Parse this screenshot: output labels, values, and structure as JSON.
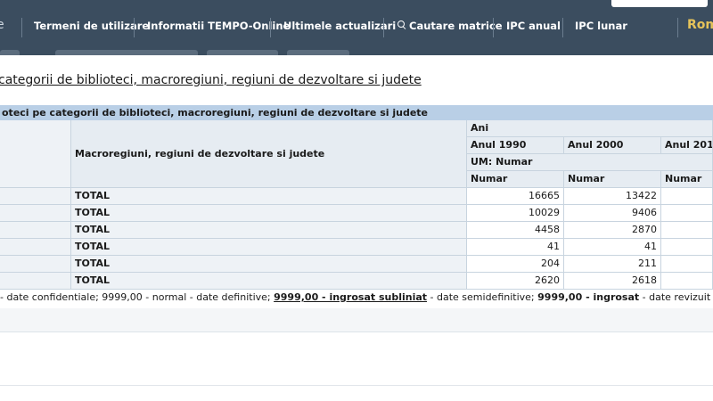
{
  "nav": {
    "left_fragment": "e",
    "items": [
      "Termeni de utilizare",
      "Informatii TEMPO-Online",
      "Ultimele actualizari",
      "Cautare matrice",
      "IPC anual",
      "IPC lunar"
    ],
    "brand_fragment": "Rom"
  },
  "page_title": "categorii de biblioteci, macroregiuni, regiuni de dezvoltare si judete",
  "table": {
    "header_bar": "oteci pe categorii de biblioteci, macroregiuni, regiuni de dezvoltare si judete",
    "row_header": "Macroregiuni, regiuni de dezvoltare si judete",
    "ani_label": "Ani",
    "years": [
      "Anul 1990",
      "Anul 2000",
      "Anul 201"
    ],
    "um_label": "UM: Numar",
    "unit_labels": [
      "Numar",
      "Numar",
      "Numar"
    ],
    "rows": [
      {
        "label": "TOTAL",
        "v1990": "16665",
        "v2000": "13422"
      },
      {
        "label": "TOTAL",
        "v1990": "10029",
        "v2000": "9406"
      },
      {
        "label": "TOTAL",
        "v1990": "4458",
        "v2000": "2870"
      },
      {
        "label": "TOTAL",
        "v1990": "41",
        "v2000": "41"
      },
      {
        "label": "TOTAL",
        "v1990": "204",
        "v2000": "211"
      },
      {
        "label": "TOTAL",
        "v1990": "2620",
        "v2000": "2618"
      }
    ]
  },
  "legend": {
    "part1": "- date confidentiale; 9999,00 - normal - date definitive; ",
    "bold_ul": "9999,00 - ingrosat subliniat",
    "part2": " - date semidefinitive; ",
    "bold": "9999,00 - ingrosat",
    "part3": " - date revizuit"
  }
}
